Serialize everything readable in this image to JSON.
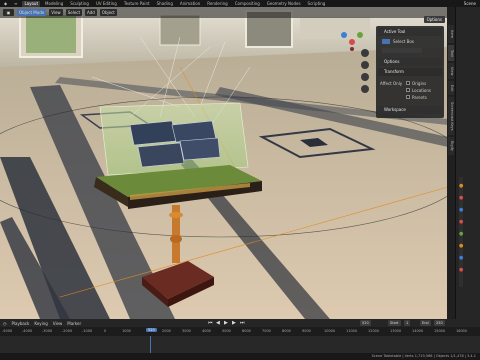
{
  "topbar": {
    "tabs": [
      "Layout",
      "Modeling",
      "Sculpting",
      "UV Editing",
      "Texture Paint",
      "Shading",
      "Animation",
      "Rendering",
      "Compositing",
      "Geometry Nodes",
      "Scripting"
    ],
    "active_tab": "Layout",
    "scene": "Scene"
  },
  "viewport": {
    "mode": "Object Mode",
    "view_menu": "View",
    "select_menu": "Select",
    "add_menu": "Add",
    "object_menu": "Object",
    "options": "Options"
  },
  "npanel": {
    "active_tool": "Active Tool",
    "select_box": "Select Box",
    "options": "Options",
    "transform": "Transform",
    "affect_only": "Affect Only",
    "origins": "Origins",
    "locations": "Locations",
    "parents": "Parents",
    "workspace": "Workspace"
  },
  "sidetabs": [
    "Item",
    "Tool",
    "View",
    "Edit",
    "Screencast Keys",
    "Rigify"
  ],
  "timeline": {
    "playback": "Playback",
    "keying": "Keying",
    "view": "View",
    "marker": "Marker",
    "current_frame": "520",
    "start_label": "Start",
    "start": "1",
    "end_label": "End",
    "end": "250",
    "ticks": [
      "-5000",
      "-4000",
      "-3000",
      "-2000",
      "-1000",
      "0",
      "1000",
      "2000",
      "3000",
      "4000",
      "5000",
      "6000",
      "7000",
      "8000",
      "9000",
      "10000",
      "11000",
      "12000",
      "13000",
      "14000",
      "15000",
      "16000",
      "17000"
    ]
  },
  "status": {
    "text": "Scene Tabletable | Verts 1,719,566 | Objects 1/1,478 | 3.4.1"
  },
  "colors": {
    "accent": "#4772b3",
    "floor": "#c9b79a",
    "marble_dark": "#2a2f3a"
  }
}
